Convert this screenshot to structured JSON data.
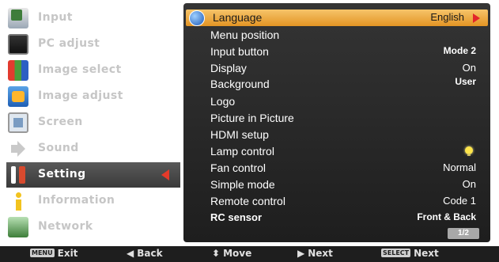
{
  "left_menu": {
    "items": [
      {
        "label": "Input",
        "icon": "input-icon"
      },
      {
        "label": "PC adjust",
        "icon": "pc-adjust-icon"
      },
      {
        "label": "Image select",
        "icon": "image-select-icon"
      },
      {
        "label": "Image adjust",
        "icon": "image-adjust-icon"
      },
      {
        "label": "Screen",
        "icon": "screen-icon"
      },
      {
        "label": "Sound",
        "icon": "sound-icon"
      },
      {
        "label": "Setting",
        "icon": "setting-icon"
      },
      {
        "label": "Information",
        "icon": "information-icon"
      },
      {
        "label": "Network",
        "icon": "network-icon"
      }
    ],
    "selected": "Setting"
  },
  "setting_panel": {
    "rows": [
      {
        "name": "Language",
        "value": "English"
      },
      {
        "name": "Menu position",
        "value": ""
      },
      {
        "name": "Input button",
        "value": "Mode 2"
      },
      {
        "name": "Display",
        "value": "On"
      },
      {
        "name": "Background",
        "value": "User"
      },
      {
        "name": "Logo",
        "value": ""
      },
      {
        "name": "Picture in Picture",
        "value": ""
      },
      {
        "name": "HDMI setup",
        "value": ""
      },
      {
        "name": "Lamp control",
        "value": "",
        "icon": "lamp-bulb-icon"
      },
      {
        "name": "Fan control",
        "value": "Normal"
      },
      {
        "name": "Simple mode",
        "value": "On"
      },
      {
        "name": "Remote control",
        "value": "Code 1"
      },
      {
        "name": "RC sensor",
        "value": "Front & Back"
      }
    ],
    "page": "1/2"
  },
  "bottom_bar": {
    "exit_key": "MENU",
    "exit_label": "Exit",
    "back_label": "Back",
    "move_label": "Move",
    "next_label": "Next",
    "select_key": "SELECT",
    "select_label": "Next"
  },
  "colors": {
    "highlight": "#e8a030",
    "panel_bg": "#2a2a2a",
    "pointer_red": "#e53a2a"
  }
}
